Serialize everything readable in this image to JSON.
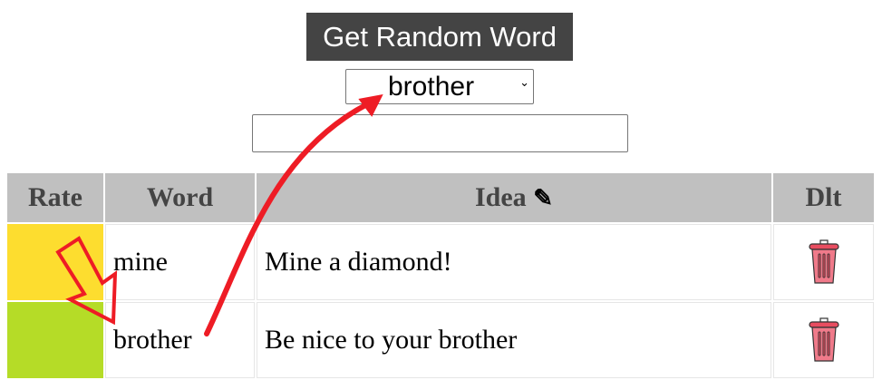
{
  "controls": {
    "random_button": "Get Random Word",
    "selected_word": "brother",
    "idea_input_value": "",
    "idea_input_placeholder": ""
  },
  "table": {
    "headers": {
      "rate": "Rate",
      "word": "Word",
      "idea": "Idea",
      "dlt": "Dlt"
    },
    "rows": [
      {
        "rate_color": "#fddd2f",
        "word": "mine",
        "idea": "Mine a diamond!"
      },
      {
        "rate_color": "#b5dc27",
        "word": "brother",
        "idea": "Be nice to your brother"
      }
    ]
  },
  "icons": {
    "edit": "pencil-icon",
    "delete": "trash-icon"
  },
  "colors": {
    "button_bg": "#444444",
    "header_bg": "#c0c0c0",
    "annotation": "#ee1c25",
    "trash": "#f07a8a"
  }
}
